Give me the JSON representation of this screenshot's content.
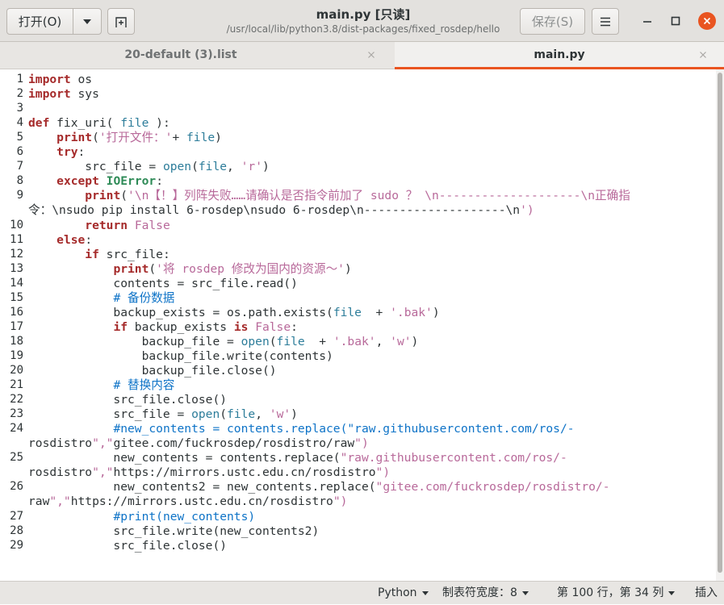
{
  "header": {
    "open_label": "打开(O)",
    "save_label": "保存(S)",
    "title": "main.py [只读]",
    "subtitle": "/usr/local/lib/python3.8/dist-packages/fixed_rosdep/hello"
  },
  "tabs": [
    {
      "label": "20-default (3).list",
      "active": false
    },
    {
      "label": "main.py",
      "active": true
    }
  ],
  "status": {
    "language": "Python",
    "tab_width": "制表符宽度：8",
    "position": "第 100 行，第 34 列",
    "mode": "插入"
  },
  "colors": {
    "accent": "#e95420",
    "keyword": "#a52a2a",
    "string": "#b8699a",
    "comment": "#0e73c7"
  },
  "lines": [
    {
      "n": "1",
      "t": "import os"
    },
    {
      "n": "2",
      "t": "import sys"
    },
    {
      "n": "3",
      "t": ""
    },
    {
      "n": "4",
      "t": "def fix_uri( file ):"
    },
    {
      "n": "5",
      "t": "    print('打开文件：'+ file)"
    },
    {
      "n": "6",
      "t": "    try:"
    },
    {
      "n": "7",
      "t": "        src_file = open(file, 'r')"
    },
    {
      "n": "8",
      "t": "    except IOError:"
    },
    {
      "n": "9",
      "t": "        print('\\n【！】列阵失败……请确认是否指令前加了 sudo ？ \\n--------------------\\n正确指"
    },
    {
      "n": "",
      "t": "令：\\nsudo pip install 6-rosdep\\nsudo 6-rosdep\\n--------------------\\n')"
    },
    {
      "n": "10",
      "t": "        return False"
    },
    {
      "n": "11",
      "t": "    else:"
    },
    {
      "n": "12",
      "t": "        if src_file:"
    },
    {
      "n": "13",
      "t": "            print('将 rosdep 修改为国内的资源～')"
    },
    {
      "n": "14",
      "t": "            contents = src_file.read()"
    },
    {
      "n": "15",
      "t": "            # 备份数据"
    },
    {
      "n": "16",
      "t": "            backup_exists = os.path.exists(file  + '.bak')"
    },
    {
      "n": "17",
      "t": "            if backup_exists is False:"
    },
    {
      "n": "18",
      "t": "                backup_file = open(file  + '.bak', 'w')"
    },
    {
      "n": "19",
      "t": "                backup_file.write(contents)"
    },
    {
      "n": "20",
      "t": "                backup_file.close()"
    },
    {
      "n": "21",
      "t": "            # 替换内容"
    },
    {
      "n": "22",
      "t": "            src_file.close()"
    },
    {
      "n": "23",
      "t": "            src_file = open(file, 'w')"
    },
    {
      "n": "24",
      "t": "            #new_contents = contents.replace(\"raw.githubusercontent.com/ros/-"
    },
    {
      "n": "",
      "t": "rosdistro\",\"gitee.com/fuckrosdep/rosdistro/raw\")"
    },
    {
      "n": "25",
      "t": "            new_contents = contents.replace(\"raw.githubusercontent.com/ros/-"
    },
    {
      "n": "",
      "t": "rosdistro\",\"https://mirrors.ustc.edu.cn/rosdistro\")"
    },
    {
      "n": "26",
      "t": "            new_contents2 = new_contents.replace(\"gitee.com/fuckrosdep/rosdistro/-"
    },
    {
      "n": "",
      "t": "raw\",\"https://mirrors.ustc.edu.cn/rosdistro\")"
    },
    {
      "n": "27",
      "t": "            #print(new_contents)"
    },
    {
      "n": "28",
      "t": "            src_file.write(new_contents2)"
    },
    {
      "n": "29",
      "t": "            src_file.close()"
    }
  ]
}
